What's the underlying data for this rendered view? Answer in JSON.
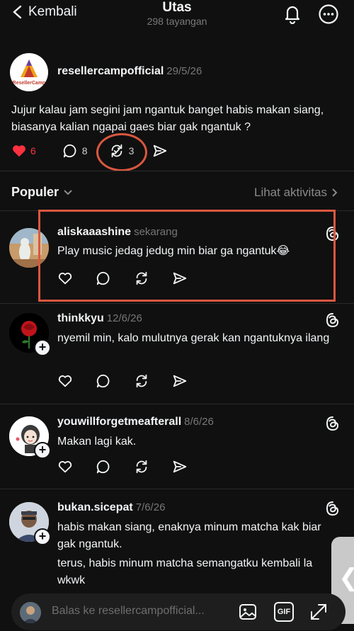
{
  "header": {
    "back_label": "Kembali",
    "title": "Utas",
    "views": "298 tayangan"
  },
  "main_post": {
    "username": "resellercampofficial",
    "date": "29/5/26",
    "avatar_text": "ResellerCamp",
    "text": "Jujur kalau jam segini jam ngantuk banget habis makan siang, biasanya kalian ngapai gaes biar gak ngantuk ?",
    "likes": "6",
    "comments": "8",
    "reposts": "3",
    "accent_like": "#ff3040"
  },
  "sort": {
    "label": "Populer",
    "activity_link": "Lihat aktivitas"
  },
  "replies": [
    {
      "username": "aliskaaashine",
      "date": "sekarang",
      "text": "Play music jedag jedug min biar ga ngantuk😂"
    },
    {
      "username": "thinkkyu",
      "date": "12/6/26",
      "text": "nyemil min, kalo mulutnya gerak kan ngantuknya ilang"
    },
    {
      "username": "youwillforgetmeafterall",
      "date": "8/6/26",
      "text": "Makan lagi kak."
    },
    {
      "username": "bukan.sicepat",
      "date": "7/6/26",
      "text": "habis makan siang, enaknya minum matcha kak biar gak ngantuk.",
      "text2": "terus, habis minum matcha semangatku kembali la wkwk"
    }
  ],
  "composer": {
    "placeholder": "Balas ke resellercampofficial...",
    "gif_label": "GIF"
  },
  "colors": {
    "background": "#101010",
    "highlight": "#d9573f"
  }
}
